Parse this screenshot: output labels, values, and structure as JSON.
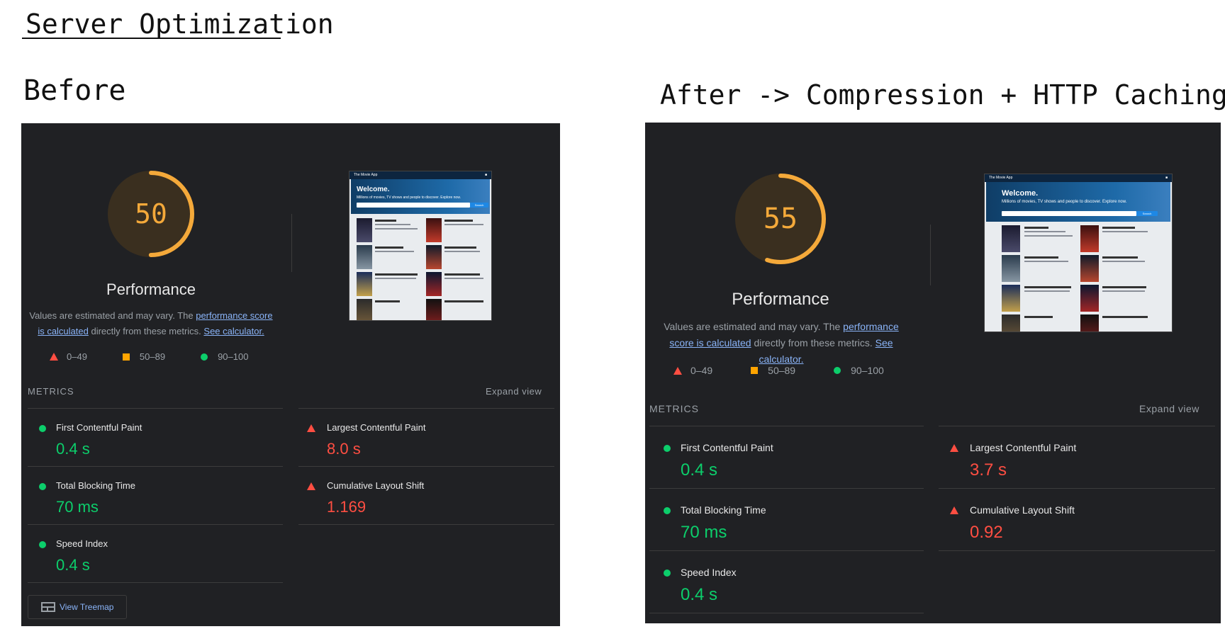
{
  "page_title": "Server Optimization",
  "before": {
    "label": "Before",
    "score": "50",
    "score_value": 50,
    "category": "Performance",
    "desc_prefix": "Values are estimated and may vary. The ",
    "desc_link1": "performance score is calculated",
    "desc_mid": " directly from these metrics. ",
    "desc_link2": "See calculator.",
    "legend": [
      "0–49",
      "50–89",
      "90–100"
    ],
    "metrics_heading": "METRICS",
    "expand_label": "Expand view",
    "metrics": [
      {
        "name": "First Contentful Paint",
        "value": "0.4 s",
        "status": "pass"
      },
      {
        "name": "Largest Contentful Paint",
        "value": "8.0 s",
        "status": "fail"
      },
      {
        "name": "Total Blocking Time",
        "value": "70 ms",
        "status": "pass"
      },
      {
        "name": "Cumulative Layout Shift",
        "value": "1.169",
        "status": "fail"
      },
      {
        "name": "Speed Index",
        "value": "0.4 s",
        "status": "pass"
      }
    ],
    "treemap_label": "View Treemap"
  },
  "after": {
    "label": "After -> Compression + HTTP Caching",
    "score": "55",
    "score_value": 55,
    "category": "Performance",
    "desc_prefix": "Values are estimated and may vary. The ",
    "desc_link1": "performance score is calculated",
    "desc_mid": " directly from these metrics. ",
    "desc_link2": "See calculator.",
    "legend": [
      "0–49",
      "50–89",
      "90–100"
    ],
    "metrics_heading": "METRICS",
    "expand_label": "Expand view",
    "metrics": [
      {
        "name": "First Contentful Paint",
        "value": "0.4 s",
        "status": "pass"
      },
      {
        "name": "Largest Contentful Paint",
        "value": "3.7 s",
        "status": "fail"
      },
      {
        "name": "Total Blocking Time",
        "value": "70 ms",
        "status": "pass"
      },
      {
        "name": "Cumulative Layout Shift",
        "value": "0.92",
        "status": "fail"
      },
      {
        "name": "Speed Index",
        "value": "0.4 s",
        "status": "pass"
      }
    ]
  },
  "thumbnail": {
    "app_name": "The Movie App",
    "welcome": "Welcome.",
    "subtitle": "Millions of movies, TV shows and people to discover. Explore now.",
    "search_button": "Search"
  },
  "colors": {
    "panel_bg": "#202124",
    "average": "#f4a93a",
    "pass": "#0cce6b",
    "fail": "#ff4e42",
    "link": "#8ab4f8"
  }
}
